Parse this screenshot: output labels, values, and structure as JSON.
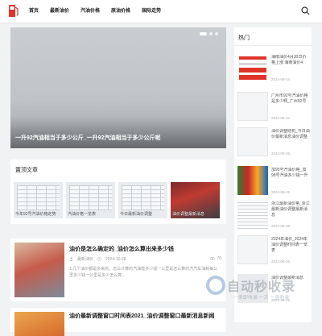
{
  "nav": {
    "items": [
      "首页",
      "最新油价",
      "汽油价格",
      "原油价格",
      "国际走势"
    ]
  },
  "slider": {
    "caption": "一升92汽油相当于多少公斤_一升92汽油相当于多少公斤呢",
    "active_index": 0,
    "count": 3
  },
  "featured": {
    "title": "置顶文章",
    "cards": [
      "今年92号汽油价格走势",
      "汽油价格一览表",
      "今日最新油价调整",
      "油价调整最新消息"
    ]
  },
  "article": {
    "title": "油价是怎么确定的_油价怎么算出来多少钱",
    "author": "最新油价",
    "date": "2024-10-28",
    "views": "70",
    "excerpt": "1.几个油价都是多来的。怎么计算的汽油能多少钱一公里是怎么算的汽汽车油耗每公里多少钱一公里是多少怎么算..."
  },
  "article2": {
    "title": "油价最新调整窗口时间表2021_油价调整窗口最新消息新闻"
  },
  "sidebar": {
    "title": "热门",
    "items": [
      {
        "title": "海南油价4月30日价格上涨 海南油价4",
        "date": "2024-06-24"
      },
      {
        "title": "广州市92号汽油价格是多少啊_广州92号",
        "date": "2024-06-24"
      },
      {
        "title": "油价调整结构_今日油价最新消息油价调整",
        "date": "2024-06-25"
      },
      {
        "title": "加95号汽油价格_加98号汽油多少钱一升",
        "date": "2024-06-25"
      },
      {
        "title": "浙江最新油价格_浙江最新油价调整最新消息",
        "date": "2024-06-25"
      },
      {
        "title": "2024年油价_2024年油价调整时间表一览表",
        "date": "2024-06-25"
      },
      {
        "title": "油价调整最新消息",
        "date": "2024-06-25"
      }
    ]
  },
  "watermark": {
    "text": "自动秒收录",
    "sub": "一来即收录 一次 一直收录"
  },
  "colors": {
    "brand_red": "#e0342b",
    "background": "#f1f2f3"
  }
}
